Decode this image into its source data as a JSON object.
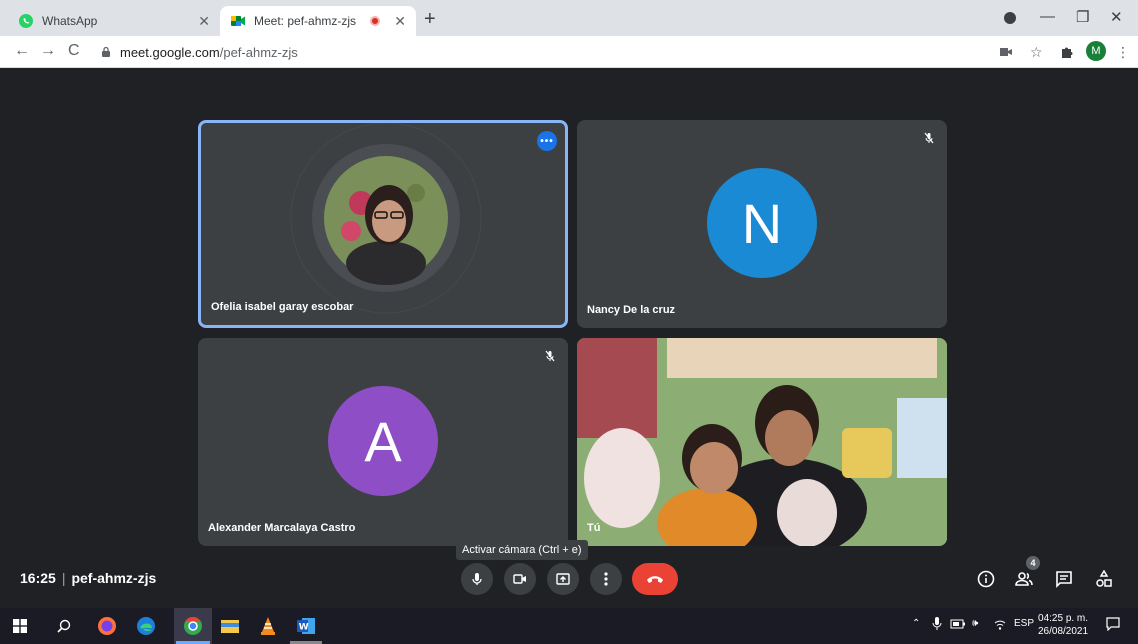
{
  "browser": {
    "tabs": [
      {
        "title": "WhatsApp",
        "icon": "whatsapp-icon"
      },
      {
        "title": "Meet: pef-ahmz-zjs",
        "icon": "meet-icon",
        "recording": true
      }
    ],
    "url_host": "meet.google.com",
    "url_path": "/pef-ahmz-zjs",
    "profile_initial": "M"
  },
  "meet": {
    "participants": [
      {
        "name": "Ofelia isabel garay escobar",
        "type": "photo",
        "active": true
      },
      {
        "name": "Nancy De la cruz",
        "type": "letter",
        "letter": "N",
        "color": "#1a8ad4",
        "muted": true
      },
      {
        "name": "Alexander Marcalaya Castro",
        "type": "letter",
        "letter": "A",
        "color": "#8e4ec6",
        "muted": true
      },
      {
        "name": "Tú",
        "type": "video"
      }
    ],
    "tooltip": "Activar cámara (Ctrl + e)",
    "time": "16:25",
    "separator": "|",
    "meeting_code": "pef-ahmz-zjs",
    "participant_count": "4",
    "end_call_color": "#ea4335",
    "active_border_color": "#8ab4f8"
  },
  "taskbar": {
    "language": "ESP",
    "clock_time": "04:25 p. m.",
    "clock_date": "26/08/2021"
  }
}
